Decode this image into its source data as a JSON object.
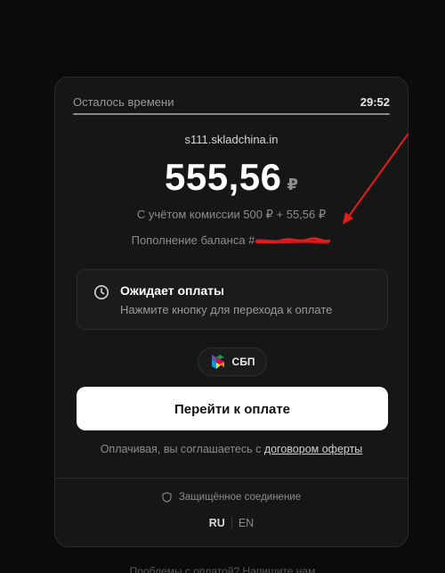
{
  "timer": {
    "label": "Осталось времени",
    "value": "29:52",
    "progress": 1.0
  },
  "payment": {
    "merchant": "s111.skladchina.in",
    "amount": "555,56",
    "currency": "₽",
    "commission": "С учётом комиссии 500 ₽ + 55,56 ₽",
    "topup_label": "Пополнение баланса #"
  },
  "status": {
    "icon": "clock-icon",
    "title": "Ожидает оплаты",
    "subtitle": "Нажмите кнопку для перехода к оплате"
  },
  "method": {
    "icon": "sbp-logo-icon",
    "label": "СБП"
  },
  "actions": {
    "pay_label": "Перейти к оплате"
  },
  "agreement": {
    "prefix": "Оплачивая, вы соглашаетесь с ",
    "link": "договором оферты"
  },
  "footer": {
    "secure_icon": "shield-icon",
    "secure_label": "Защищённое соединение",
    "lang_ru": "RU",
    "lang_en": "EN",
    "bottom_text": "Проблемы с оплатой? Напишите нам"
  },
  "colors": {
    "background": "#0b0b0b",
    "card": "#161616",
    "button": "#ffffff",
    "annotation": "#e01e1e",
    "redaction": "#e01e1e"
  }
}
